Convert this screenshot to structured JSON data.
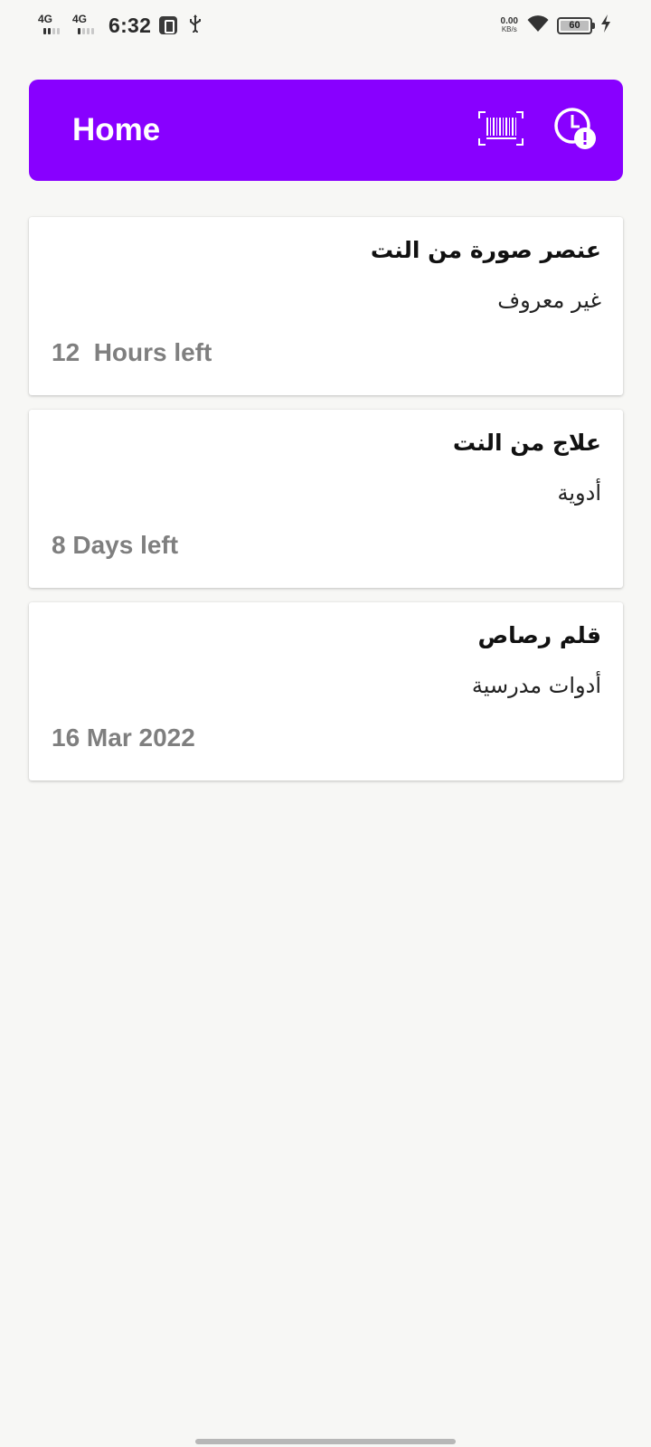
{
  "status_bar": {
    "network_1": "4G",
    "network_2": "4G",
    "time": "6:32",
    "speed_value": "0.00",
    "speed_unit": "KB/s",
    "battery": "60"
  },
  "app_bar": {
    "title": "Home",
    "barcode_icon": "barcode-scan-icon",
    "history_icon": "clock-alert-icon",
    "color": "#8800ff"
  },
  "items": [
    {
      "title": "عنصر صورة من النت",
      "category": "غير معروف",
      "time_left": "12  Hours left"
    },
    {
      "title": "علاج من النت",
      "category": "أدوية",
      "time_left": "8 Days left"
    },
    {
      "title": "قلم رصاص",
      "category": "أدوات مدرسية",
      "time_left": "16 Mar 2022"
    }
  ]
}
